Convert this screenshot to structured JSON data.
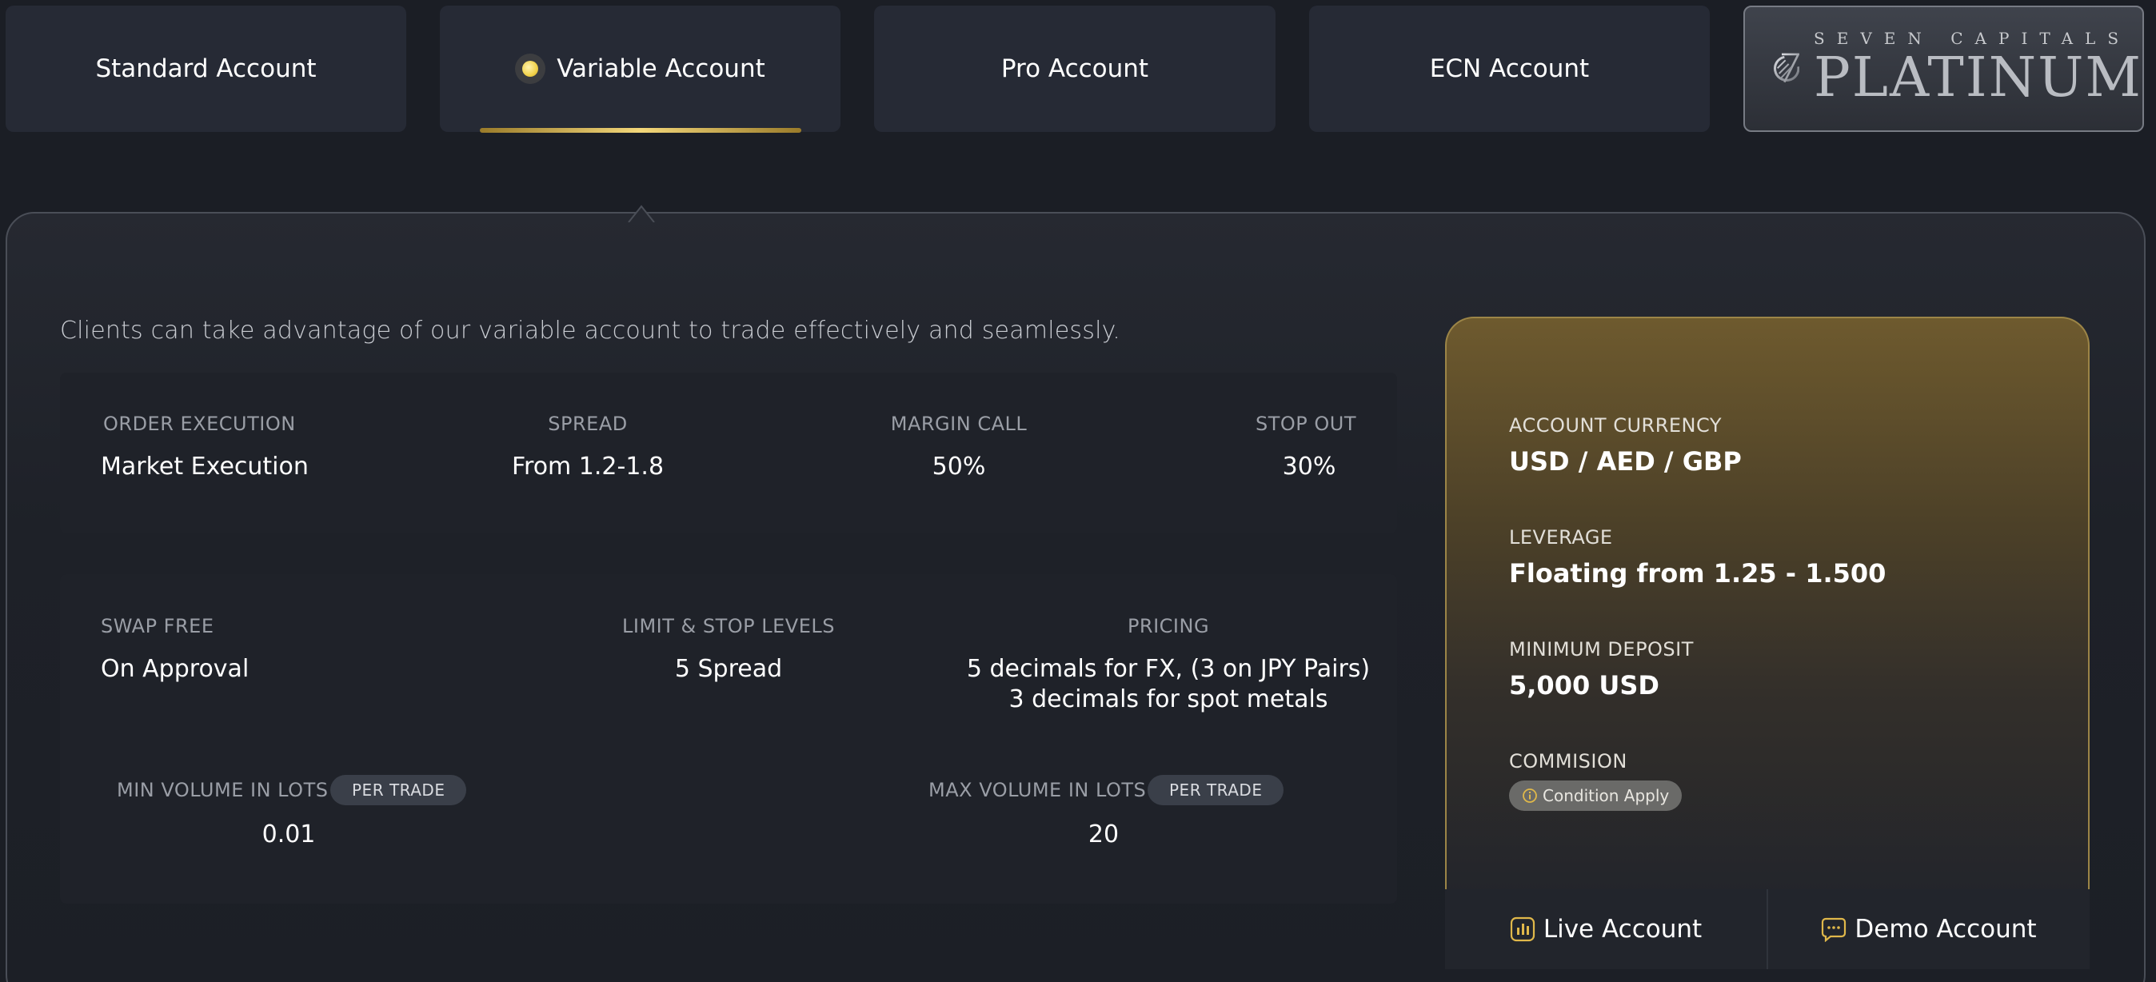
{
  "tabs": [
    {
      "label": "Standard Account"
    },
    {
      "label": "Variable Account",
      "active": true
    },
    {
      "label": "Pro Account"
    },
    {
      "label": "ECN Account"
    }
  ],
  "logo": {
    "sub": "SEVEN CAPITALS",
    "main": "PLATINUM"
  },
  "intro": "Clients can take advantage of our variable account to trade effectively and seamlessly.",
  "specs": {
    "order_execution": {
      "label": "ORDER EXECUTION",
      "value": "Market Execution"
    },
    "spread": {
      "label": "SPREAD",
      "value": "From 1.2-1.8"
    },
    "margin_call": {
      "label": "MARGIN CALL",
      "value": "50%"
    },
    "stop_out": {
      "label": "STOP OUT",
      "value": "30%"
    },
    "swap_free": {
      "label": "SWAP FREE",
      "value": "On Approval"
    },
    "limit_stop": {
      "label": "LIMIT & STOP LEVELS",
      "value": "5 Spread"
    },
    "pricing": {
      "label": "PRICING",
      "value_line1": "5 decimals for FX, (3 on JPY Pairs)",
      "value_line2": "3 decimals for spot metals"
    },
    "min_volume": {
      "label": "MIN VOLUME IN LOTS",
      "badge": "PER TRADE",
      "value": "0.01"
    },
    "max_volume": {
      "label": "MAX VOLUME IN LOTS",
      "badge": "PER TRADE",
      "value": "20"
    }
  },
  "side": {
    "currency": {
      "label": "ACCOUNT CURRENCY",
      "value": "USD / AED / GBP"
    },
    "leverage": {
      "label": "LEVERAGE",
      "value": "Floating from 1.25 - 1.500"
    },
    "deposit": {
      "label": "MINIMUM DEPOSIT",
      "value": "5,000 USD"
    },
    "commission": {
      "label": "COMMISION",
      "badge": "Condition Apply"
    }
  },
  "actions": {
    "live": "Live Account",
    "demo": "Demo Account"
  },
  "colors": {
    "background": "#1b1e25",
    "tab": "#262a35",
    "gold_accent": "#f3d77a",
    "card": "#1f2229"
  }
}
